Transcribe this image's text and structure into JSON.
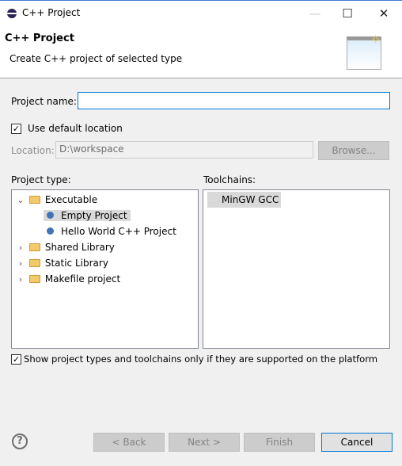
{
  "window": {
    "title": "C++ Project",
    "minimize": "—",
    "maximize": "☐",
    "close": "✕"
  },
  "header": {
    "title": "C++ Project",
    "description": "Create C++ project of selected type"
  },
  "form": {
    "project_name_label": "Project name:",
    "project_name_value": "",
    "use_default_location_label": "Use default location",
    "use_default_location_checked": true,
    "location_label": "Location:",
    "location_value": "D:\\workspace",
    "browse_label": "Browse..."
  },
  "project_type": {
    "label": "Project type:",
    "items": [
      {
        "label": "Executable",
        "level": 0,
        "expanded": true,
        "icon": "folder-icon"
      },
      {
        "label": "Empty Project",
        "level": 1,
        "selected": true,
        "icon": "bullet-icon"
      },
      {
        "label": "Hello World C++ Project",
        "level": 1,
        "icon": "bullet-icon"
      },
      {
        "label": "Shared Library",
        "level": 0,
        "expanded": false,
        "icon": "folder-icon"
      },
      {
        "label": "Static Library",
        "level": 0,
        "expanded": false,
        "icon": "folder-icon"
      },
      {
        "label": "Makefile project",
        "level": 0,
        "expanded": false,
        "icon": "folder-icon"
      }
    ]
  },
  "toolchains": {
    "label": "Toolchains:",
    "items": [
      "MinGW GCC"
    ]
  },
  "show_supported": {
    "label": "Show project types and toolchains only if they are supported on the platform",
    "checked": true
  },
  "buttons": {
    "back": "< Back",
    "next": "Next >",
    "finish": "Finish",
    "cancel": "Cancel",
    "help": "?"
  }
}
